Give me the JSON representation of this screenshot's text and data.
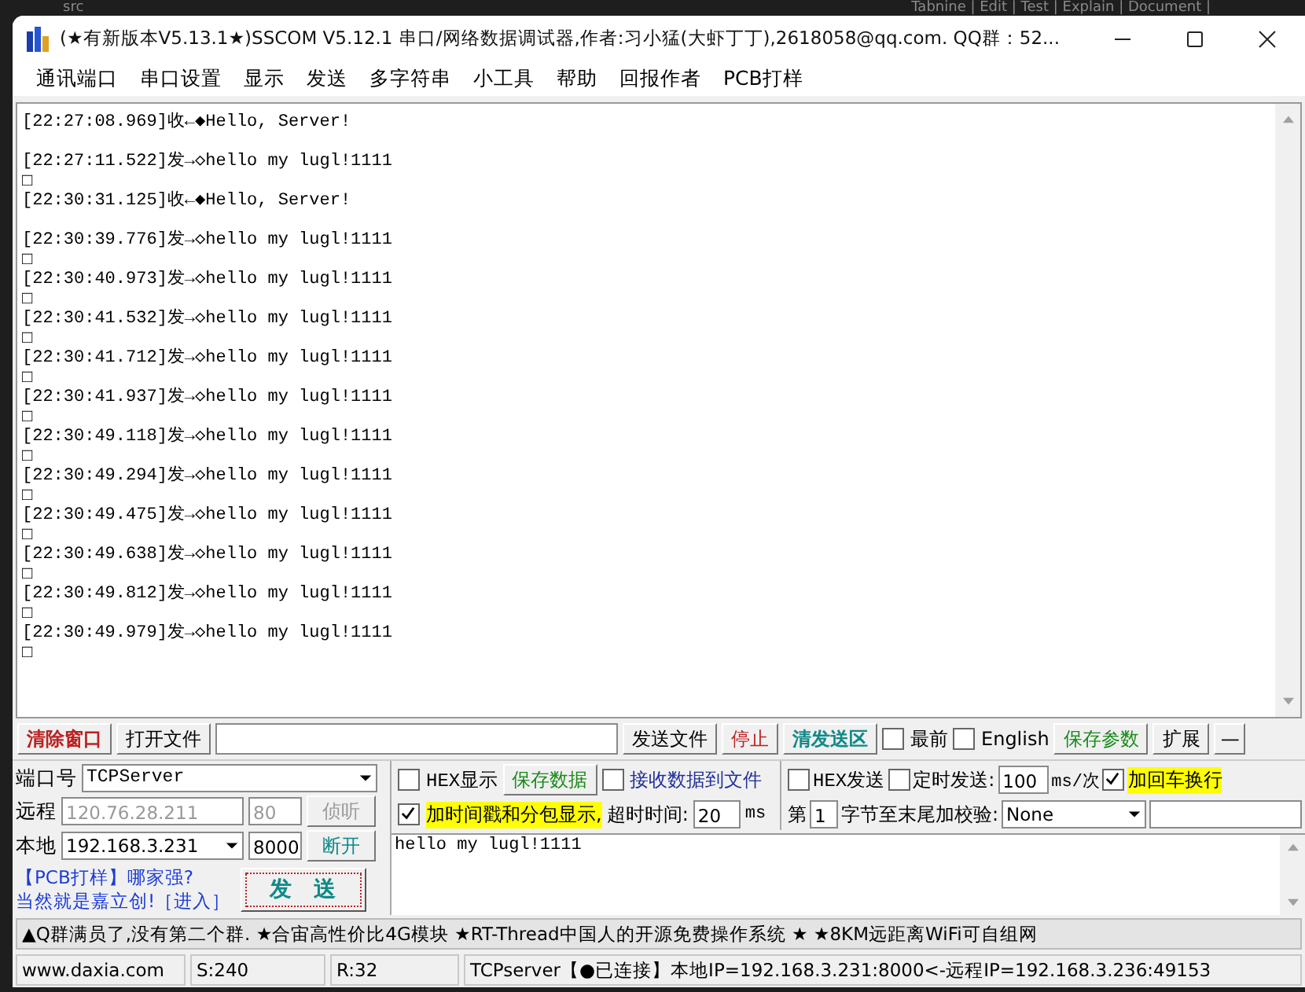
{
  "background": {
    "folder": "src",
    "codelens": "Tabnine | Edit | Test | Explain | Document |"
  },
  "window": {
    "title": "(★有新版本V5.13.1★)SSCOM V5.12.1 串口/网络数据调试器,作者:习小猛(大虾丁丁),2618058@qq.com. QQ群：52...",
    "menu": [
      "通讯端口",
      "串口设置",
      "显示",
      "发送",
      "多字符串",
      "小工具",
      "帮助",
      "回报作者",
      "PCB打样"
    ]
  },
  "log": [
    {
      "text": "[22:27:08.969]收←◆Hello, Server!"
    },
    {
      "text": "[22:27:11.522]发→◇hello my lugl!1111",
      "tail": "□"
    },
    {
      "text": "[22:30:31.125]收←◆Hello, Server!"
    },
    {
      "text": "[22:30:39.776]发→◇hello my lugl!1111",
      "tail": "□"
    },
    {
      "text": "[22:30:40.973]发→◇hello my lugl!1111",
      "tail": "□"
    },
    {
      "text": "[22:30:41.532]发→◇hello my lugl!1111",
      "tail": "□"
    },
    {
      "text": "[22:30:41.712]发→◇hello my lugl!1111",
      "tail": "□"
    },
    {
      "text": "[22:30:41.937]发→◇hello my lugl!1111",
      "tail": "□"
    },
    {
      "text": "[22:30:49.118]发→◇hello my lugl!1111",
      "tail": "□"
    },
    {
      "text": "[22:30:49.294]发→◇hello my lugl!1111",
      "tail": "□"
    },
    {
      "text": "[22:30:49.475]发→◇hello my lugl!1111",
      "tail": "□"
    },
    {
      "text": "[22:30:49.638]发→◇hello my lugl!1111",
      "tail": "□"
    },
    {
      "text": "[22:30:49.812]发→◇hello my lugl!1111",
      "tail": "□"
    },
    {
      "text": "[22:30:49.979]发→◇hello my lugl!1111",
      "tail": "□"
    }
  ],
  "toolbar": {
    "clear_button": "清除窗口",
    "open_file_button": "打开文件",
    "send_file_button": "发送文件",
    "stop_button": "停止",
    "clear_send_button": "清发送区",
    "on_top": {
      "label": "最前",
      "checked": false
    },
    "english": {
      "label": "English",
      "checked": false
    },
    "save_params_button": "保存参数",
    "expand_button": "扩展",
    "minimize_button": "—"
  },
  "connection": {
    "port_label": "端口号",
    "port_value": "TCPServer",
    "remote_label": "远程",
    "remote_ip": "120.76.28.211",
    "remote_port": "80",
    "listen_button": {
      "label": "侦听",
      "disabled": true
    },
    "local_label": "本地",
    "local_ip": "192.168.3.231",
    "local_port": "8000",
    "disconnect_button": {
      "label": "断开",
      "disabled": false
    },
    "ad_line_1": "【PCB打样】哪家强?",
    "ad_line_2": "当然就是嘉立创!［进入］",
    "send_button": "发　送"
  },
  "receive_options": {
    "hex_display": {
      "label": "HEX显示",
      "checked": false
    },
    "save_data_button": "保存数据",
    "recv_to_file": {
      "label": "接收数据到文件",
      "checked": false
    },
    "timestamp": {
      "label": "加时间戳和分包显示,",
      "checked": true
    },
    "timeout_label": "超时时间:",
    "timeout_value": "20",
    "timeout_unit": "ms"
  },
  "send_options": {
    "hex_send": {
      "label": "HEX发送",
      "checked": false
    },
    "timed_send": {
      "label": "定时发送:",
      "checked": false
    },
    "interval": "100",
    "interval_unit": "ms/次",
    "append_crlf": {
      "label": "加回车换行",
      "checked": true
    },
    "byte_label": "第",
    "byte_value": "1",
    "checksum_label": "字节至末尾加校验:",
    "checksum_value": "None"
  },
  "send_text": "hello my lugl!1111",
  "ticker": "▲Q群满员了,没有第二个群. ★合宙高性价比4G模块 ★RT-Thread中国人的开源免费操作系统 ★ ★8KM远距离WiFi可自组网",
  "status_bar": {
    "website": "www.daxia.com",
    "sent": "S:240",
    "received": "R:32",
    "connection": "TCPserver【●已连接】本地IP=192.168.3.231:8000<-远程IP=192.168.3.236:49153"
  }
}
